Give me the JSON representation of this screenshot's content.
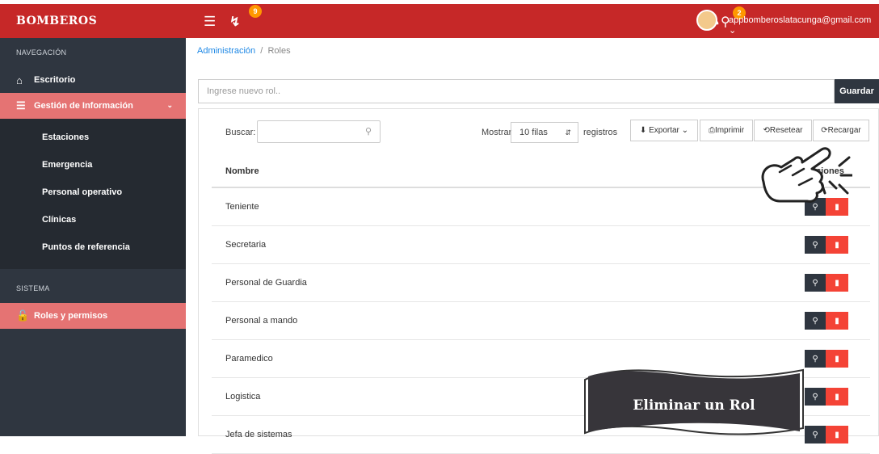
{
  "header": {
    "brand": "BOMBEROS",
    "notif_count": "9",
    "chat_count": "2",
    "user_email": "appbomberoslatacunga@gmail.com"
  },
  "sidebar": {
    "section_nav": "NAVEGACIÓN",
    "items": [
      {
        "label": "Escritorio"
      },
      {
        "label": "Gestión de Información"
      }
    ],
    "submenu": [
      "Estaciones",
      "Emergencia",
      "Personal operativo",
      "Clínicas",
      "Puntos de referencia"
    ],
    "section_system": "SISTEMA",
    "system_items": [
      {
        "label": "Roles y permisos"
      }
    ]
  },
  "breadcrumb": {
    "root": "Administración",
    "separator": "/",
    "current": "Roles"
  },
  "new_role": {
    "placeholder": "Ingrese nuevo rol..",
    "save_label": "Guardar"
  },
  "toolbar": {
    "search_label": "Buscar:",
    "show_label": "Mostrar",
    "rows_value": "10 filas",
    "records_label": "registros",
    "export_label": "Exportar",
    "print_label": "Imprimir",
    "reset_label": "Resetear",
    "reload_label": "Recargar"
  },
  "table": {
    "col_name": "Nombre",
    "col_actions": "Acciones",
    "rows": [
      "Teniente",
      "Secretaria",
      "Personal de Guardia",
      "Personal a mando",
      "Paramedico",
      "Logistica",
      "Jefa de sistemas"
    ]
  },
  "overlay": {
    "banner_text": "Eliminar un Rol"
  },
  "colors": {
    "brand": "#c62828",
    "sidebar": "#2f3640",
    "active": "#e57373",
    "danger": "#f44336"
  }
}
